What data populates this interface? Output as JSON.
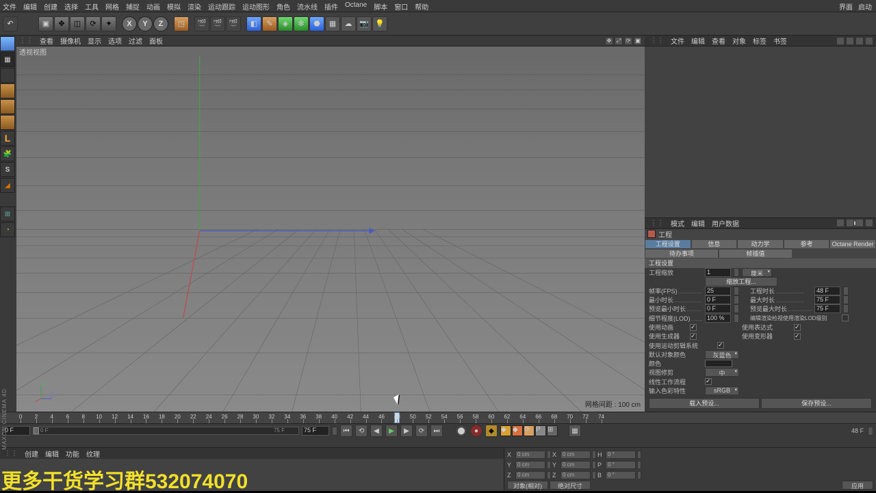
{
  "menus": [
    "文件",
    "编辑",
    "创建",
    "选择",
    "工具",
    "网格",
    "捕捉",
    "动画",
    "模拟",
    "渲染",
    "运动跟踪",
    "运动图形",
    "角色",
    "流水线",
    "插件",
    "Octane",
    "脚本",
    "窗口",
    "帮助"
  ],
  "menus_right": [
    "界面",
    "启动"
  ],
  "viewport": {
    "tabs": [
      "查看",
      "摄像机",
      "显示",
      "选项",
      "过滤",
      "面板"
    ],
    "title": "透视视图",
    "gridinfo": "网格间距 : 100 cm"
  },
  "objmgr_tabs": [
    "文件",
    "编辑",
    "查看",
    "对象",
    "标签",
    "书签"
  ],
  "attr_tabs": [
    "模式",
    "编辑",
    "用户数据"
  ],
  "attr_head": "工程",
  "attr_tabrow1": [
    "工程设置",
    "信息",
    "动力学",
    "参考",
    "Octane Render"
  ],
  "attr_tabrow2": [
    "待办事项",
    "帧插值"
  ],
  "attr_section": "工程设置",
  "props": {
    "scale_lbl": "工程缩放",
    "scale_val": "1",
    "scale_unit": "厘米",
    "rescale_btn": "缩放工程...",
    "fps_lbl": "帧率(FPS)",
    "fps_val": "25",
    "projtime_lbl": "工程时长",
    "projtime_val": "48 F",
    "mintime_lbl": "最小时长",
    "mintime_val": "0 F",
    "maxtime_lbl": "最大时长",
    "maxtime_val": "75 F",
    "prevmin_lbl": "预览最小时长",
    "prevmin_val": "0 F",
    "prevmax_lbl": "预览最大时长",
    "prevmax_val": "75 F",
    "lod_lbl": "细节程度(LOD)",
    "lod_val": "100 %",
    "lod_note": "编辑渲染检视使用渲染LOD级别",
    "use_anim_lbl": "使用动画",
    "use_expr_lbl": "使用表达式",
    "use_gen_lbl": "使用生成器",
    "use_def_lbl": "使用变形器",
    "use_motion_lbl": "使用运动剪辑系统",
    "defcolor_lbl": "默认对象颜色",
    "defcolor_val": "灰蓝色",
    "color_lbl": "颜色",
    "viewclip_lbl": "视图修剪",
    "viewclip_val": "中",
    "linear_lbl": "线性工作流程",
    "inputcolor_lbl": "输入色彩特性",
    "inputcolor_val": "sRGB",
    "btn1": "载入预设...",
    "btn2": "保存预设..."
  },
  "timeline": {
    "ticks": [
      0,
      2,
      4,
      6,
      8,
      10,
      12,
      14,
      16,
      18,
      20,
      22,
      24,
      26,
      28,
      30,
      32,
      34,
      36,
      38,
      40,
      42,
      44,
      46,
      48,
      50,
      52,
      54,
      56,
      58,
      60,
      62,
      64,
      66,
      68,
      70,
      72,
      74
    ],
    "playhead_frame": 48,
    "frame_start": "0 F",
    "frame_end": "75 F",
    "cur_frame": "0 F",
    "proj_end": "48 F",
    "end_label": "75 F"
  },
  "matmgr_tabs": [
    "创建",
    "编辑",
    "功能",
    "纹理"
  ],
  "coord": {
    "X": "0 cm",
    "Y": "0 cm",
    "Z": "0 cm",
    "sX": "0 cm",
    "sY": "0 cm",
    "sZ": "0 cm",
    "H": "0 °",
    "P": "0 °",
    "B": "0 °",
    "dd1": "对象(相对)",
    "dd2": "绝对尺寸",
    "apply": "应用"
  },
  "brand": "MAXON CINEMA 4D",
  "watermark": "更多干货学习群532074070"
}
